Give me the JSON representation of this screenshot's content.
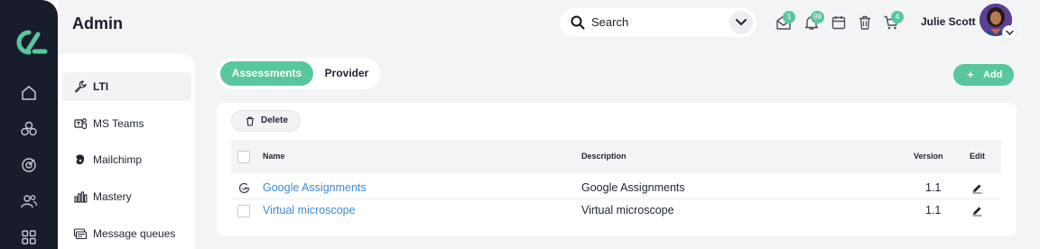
{
  "header": {
    "page_title": "Admin",
    "search_placeholder": "Search",
    "notifications": [
      {
        "icon": "mail-icon",
        "badge": "1"
      },
      {
        "icon": "bell-icon",
        "badge": "99"
      },
      {
        "icon": "calendar-icon",
        "badge": ""
      },
      {
        "icon": "trash-icon",
        "badge": ""
      },
      {
        "icon": "cart-icon",
        "badge": "4"
      }
    ],
    "user_name": "Julie Scott"
  },
  "rail": {
    "logo": "brand-logo",
    "items": [
      "home-icon",
      "modules-icon",
      "target-icon",
      "users-icon",
      "apps-icon"
    ]
  },
  "sidebar": {
    "items": [
      {
        "label": "LTI",
        "icon": "wrench-icon",
        "active": true
      },
      {
        "label": "MS Teams",
        "icon": "teams-icon",
        "active": false
      },
      {
        "label": "Mailchimp",
        "icon": "mailchimp-icon",
        "active": false
      },
      {
        "label": "Mastery",
        "icon": "bar-chart-icon",
        "active": false
      },
      {
        "label": "Message queues",
        "icon": "message-queue-icon",
        "active": false
      }
    ]
  },
  "tabs": [
    {
      "label": "Assessments",
      "active": true
    },
    {
      "label": "Provider",
      "active": false
    }
  ],
  "toolbar": {
    "add_label": "Add",
    "delete_label": "Delete"
  },
  "table": {
    "columns": [
      "Name",
      "Description",
      "Version",
      "Edit"
    ],
    "rows": [
      {
        "name": "Google Assignments",
        "description": "Google Assignments",
        "version": "1.1",
        "row_icon": "google-icon"
      },
      {
        "name": "Virtual microscope",
        "description": "Virtual microscope",
        "version": "1.1",
        "row_icon": "checkbox"
      }
    ]
  },
  "colors": {
    "accent": "#58c79d",
    "rail": "#191d2b",
    "link": "#3a8ad6",
    "background": "#f3f4f6"
  }
}
